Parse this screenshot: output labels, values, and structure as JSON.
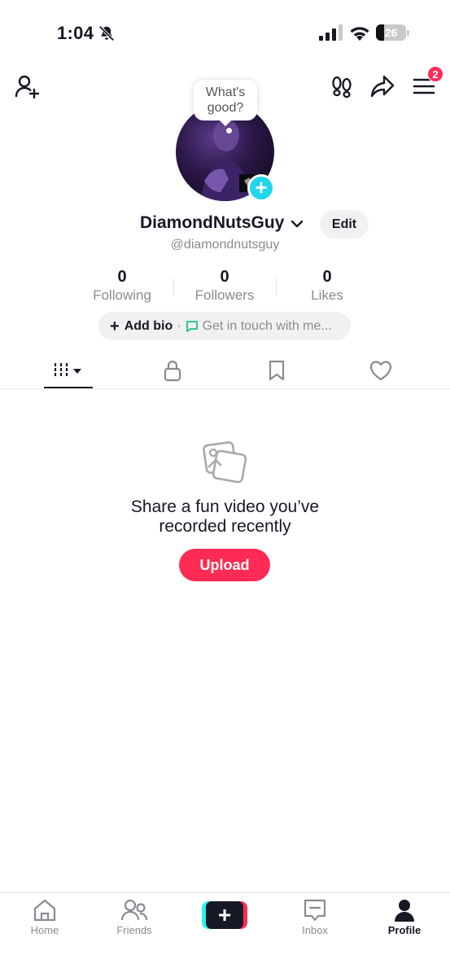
{
  "status_bar": {
    "time": "1:04",
    "battery_percent": 26,
    "battery_level": 0.26,
    "icons": [
      "bell-slash-icon",
      "signal-icon",
      "wifi-icon",
      "battery-icon"
    ]
  },
  "header": {
    "menu_badge": "2",
    "icons": [
      "add-friend-icon",
      "footprints-icon",
      "share-icon",
      "menu-icon"
    ]
  },
  "profile": {
    "bubble_text": "What's good?",
    "username": "DiamondNutsGuy",
    "handle": "@diamondnutsguy",
    "edit_label": "Edit",
    "stats": {
      "following_count": "0",
      "following_label": "Following",
      "followers_count": "0",
      "followers_label": "Followers",
      "likes_count": "0",
      "likes_label": "Likes"
    },
    "bio": {
      "plus": "+",
      "add_bio_label": "Add bio",
      "separator": "·",
      "contact_placeholder": "Get in touch with me..."
    }
  },
  "tabs": {
    "active": "videos",
    "items": [
      "videos-grid-icon",
      "lock-icon",
      "bookmark-icon",
      "heart-icon"
    ]
  },
  "empty_state": {
    "title_line1": "Share a fun video you’ve",
    "title_line2": "recorded recently",
    "upload_label": "Upload"
  },
  "bottom_nav": {
    "home": "Home",
    "friends": "Friends",
    "create": "+",
    "inbox": "Inbox",
    "profile": "Profile",
    "active": "Profile"
  },
  "colors": {
    "accent": "#fe2c55",
    "cyan": "#25f4ee",
    "avatar_add": "#20d5ec",
    "text_primary": "#161823",
    "text_secondary": "#8a8b91"
  }
}
